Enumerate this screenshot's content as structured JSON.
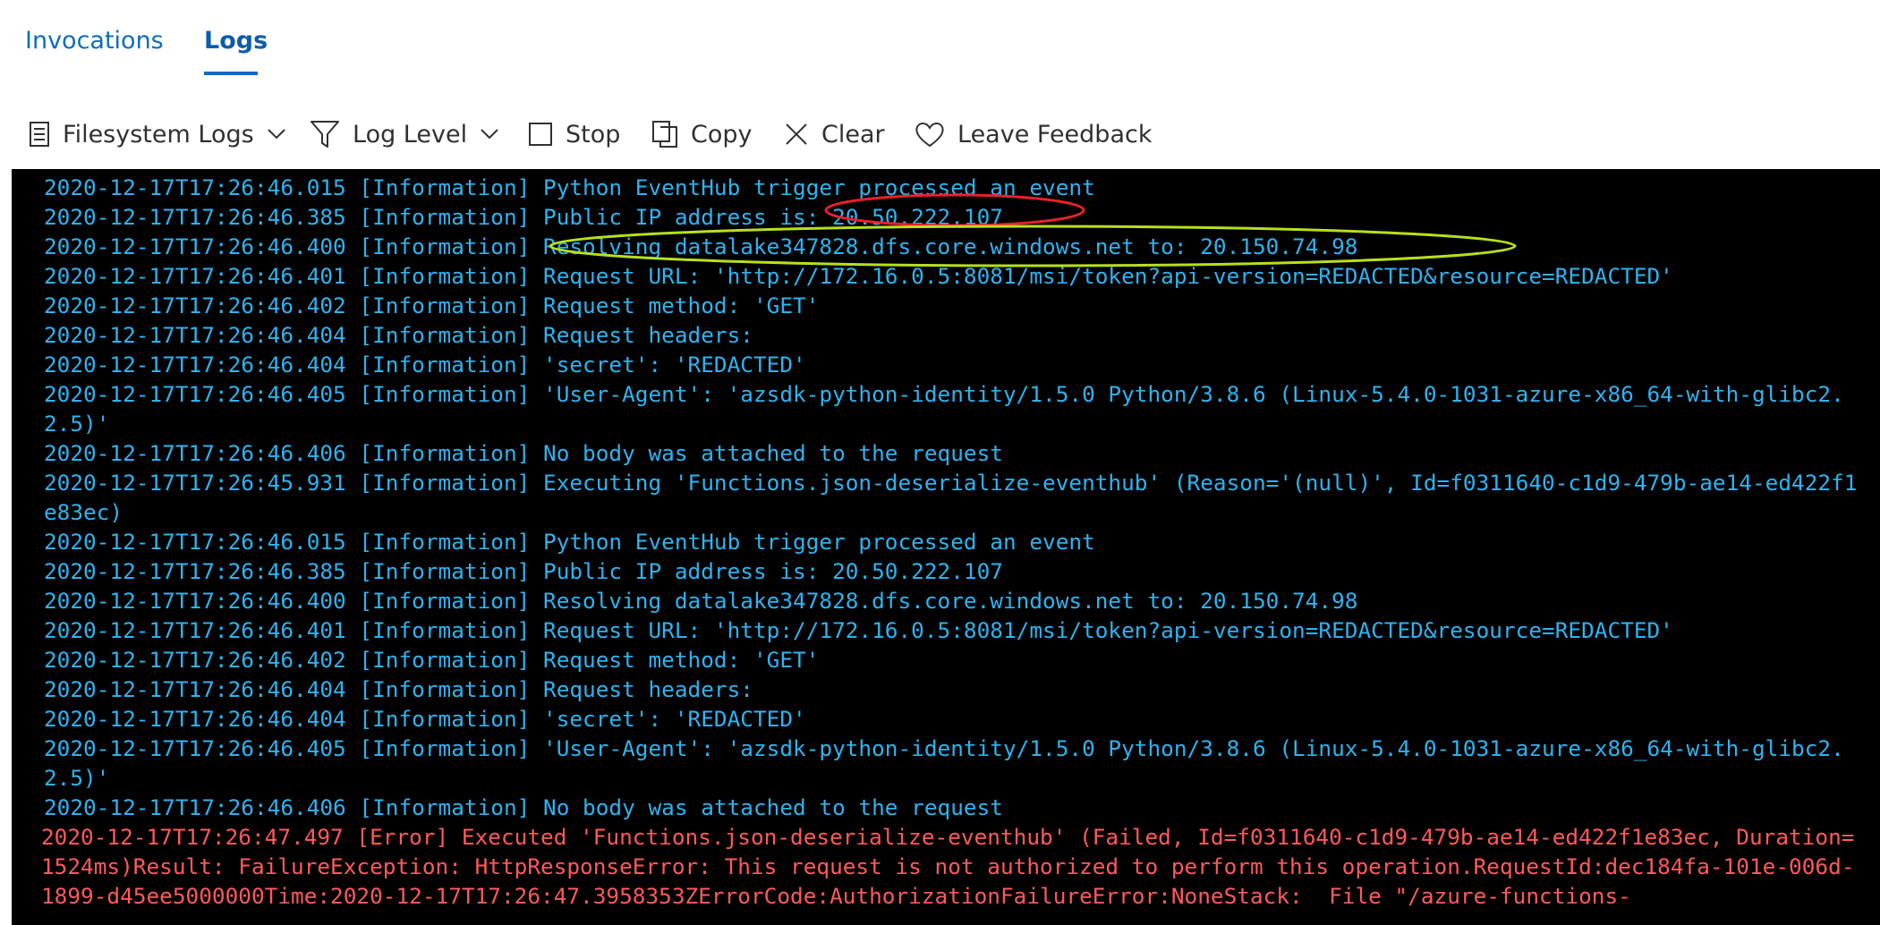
{
  "tabs": [
    {
      "label": "Invocations",
      "active": false
    },
    {
      "label": "Logs",
      "active": true
    }
  ],
  "toolbar": {
    "filesystem_logs": "Filesystem Logs",
    "log_level": "Log Level",
    "stop": "Stop",
    "copy": "Copy",
    "clear": "Clear",
    "feedback": "Leave Feedback",
    "icons": [
      "list-icon",
      "filter-icon",
      "stop-checkbox-icon",
      "copy-icon",
      "clear-x-icon",
      "heart-icon"
    ]
  },
  "colors": {
    "tab_text": "#0f6cbd",
    "info_text": "#2fb3f0",
    "error_text": "#ff5a5a",
    "console_bg": "#000000",
    "ip_annotation": "#e8202a",
    "resolve_annotation": "#b7e01d"
  },
  "log": {
    "lines": [
      {
        "level": "info",
        "text": "2020-12-17T17:26:46.015 [Information] Python EventHub trigger processed an event"
      },
      {
        "level": "info",
        "text": "2020-12-17T17:26:46.385 [Information] Public IP address is: 20.50.222.107"
      },
      {
        "level": "info",
        "text": "2020-12-17T17:26:46.400 [Information] Resolving datalake347828.dfs.core.windows.net to: 20.150.74.98"
      },
      {
        "level": "info",
        "text": "2020-12-17T17:26:46.401 [Information] Request URL: 'http://172.16.0.5:8081/msi/token?api-version=REDACTED&resource=REDACTED'"
      },
      {
        "level": "info",
        "text": "2020-12-17T17:26:46.402 [Information] Request method: 'GET'"
      },
      {
        "level": "info",
        "text": "2020-12-17T17:26:46.404 [Information] Request headers:"
      },
      {
        "level": "info",
        "text": "2020-12-17T17:26:46.404 [Information] 'secret': 'REDACTED'"
      },
      {
        "level": "info",
        "text": "2020-12-17T17:26:46.405 [Information] 'User-Agent': 'azsdk-python-identity/1.5.0 Python/3.8.6 (Linux-5.4.0-1031-azure-x86_64-with-glibc2.2.5)'"
      },
      {
        "level": "info",
        "text": "2020-12-17T17:26:46.406 [Information] No body was attached to the request"
      },
      {
        "level": "info",
        "text": "2020-12-17T17:26:45.931 [Information] Executing 'Functions.json-deserialize-eventhub' (Reason='(null)', Id=f0311640-c1d9-479b-ae14-ed422f1e83ec)"
      },
      {
        "level": "info",
        "text": "2020-12-17T17:26:46.015 [Information] Python EventHub trigger processed an event"
      },
      {
        "level": "info",
        "text": "2020-12-17T17:26:46.385 [Information] Public IP address is: 20.50.222.107"
      },
      {
        "level": "info",
        "text": "2020-12-17T17:26:46.400 [Information] Resolving datalake347828.dfs.core.windows.net to: 20.150.74.98"
      },
      {
        "level": "info",
        "text": "2020-12-17T17:26:46.401 [Information] Request URL: 'http://172.16.0.5:8081/msi/token?api-version=REDACTED&resource=REDACTED'"
      },
      {
        "level": "info",
        "text": "2020-12-17T17:26:46.402 [Information] Request method: 'GET'"
      },
      {
        "level": "info",
        "text": "2020-12-17T17:26:46.404 [Information] Request headers:"
      },
      {
        "level": "info",
        "text": "2020-12-17T17:26:46.404 [Information] 'secret': 'REDACTED'"
      },
      {
        "level": "info",
        "text": "2020-12-17T17:26:46.405 [Information] 'User-Agent': 'azsdk-python-identity/1.5.0 Python/3.8.6 (Linux-5.4.0-1031-azure-x86_64-with-glibc2.2.5)'"
      },
      {
        "level": "info",
        "text": "2020-12-17T17:26:46.406 [Information] No body was attached to the request"
      },
      {
        "level": "error",
        "text": "2020-12-17T17:26:47.497 [Error] Executed 'Functions.json-deserialize-eventhub' (Failed, Id=f0311640-c1d9-479b-ae14-ed422f1e83ec, Duration=1524ms)Result: FailureException: HttpResponseError: This request is not authorized to perform this operation.RequestId:dec184fa-101e-006d-1899-d45ee5000000Time:2020-12-17T17:26:47.3958353ZErrorCode:AuthorizationFailureError:NoneStack:  File \"/azure-functions-"
      }
    ]
  }
}
